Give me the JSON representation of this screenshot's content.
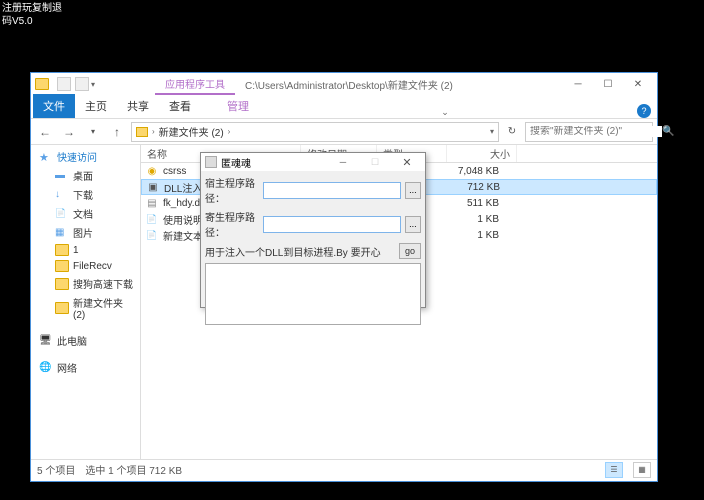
{
  "desktop": {
    "line1": "注册玩复制退",
    "line2": "码V5.0"
  },
  "explorer": {
    "contextual_tab": "应用程序工具",
    "title_path": "C:\\Users\\Administrator\\Desktop\\新建文件夹 (2)",
    "tabs": {
      "file": "文件",
      "home": "主页",
      "share": "共享",
      "view": "查看",
      "manage": "管理"
    },
    "breadcrumb": "新建文件夹 (2)",
    "search_placeholder": "搜索\"新建文件夹 (2)\"",
    "columns": {
      "name": "名称",
      "date": "修改日期",
      "type": "类型",
      "size": "大小"
    },
    "nav": {
      "quick": "快速访问",
      "desktop": "桌面",
      "downloads": "下载",
      "documents": "文档",
      "pictures": "图片",
      "one": "1",
      "filerecv": "FileRecv",
      "sogou": "搜狗高速下载",
      "newfolder": "新建文件夹 (2)",
      "pc": "此电脑",
      "network": "网络"
    },
    "files": [
      {
        "name": "csrss",
        "size": "7,048 KB",
        "icon": "exe"
      },
      {
        "name": "DLL注入启动器",
        "size": "712 KB",
        "icon": "app",
        "selected": true
      },
      {
        "name": "fk_hdy.dll",
        "size": "511 KB",
        "icon": "dll"
      },
      {
        "name": "使用说明",
        "size": "1 KB",
        "icon": "txt"
      },
      {
        "name": "新建文本文档",
        "size": "1 KB",
        "icon": "txt"
      }
    ],
    "status": {
      "count": "5 个项目",
      "selected": "选中 1 个项目  712 KB"
    }
  },
  "dialog": {
    "title": "匿魂魂",
    "label_host": "宿主程序路径：",
    "label_parasite": "寄生程序路径：",
    "desc": "用于注入一个DLL到目标进程.By 要开心",
    "go": "go",
    "browse": "..."
  }
}
